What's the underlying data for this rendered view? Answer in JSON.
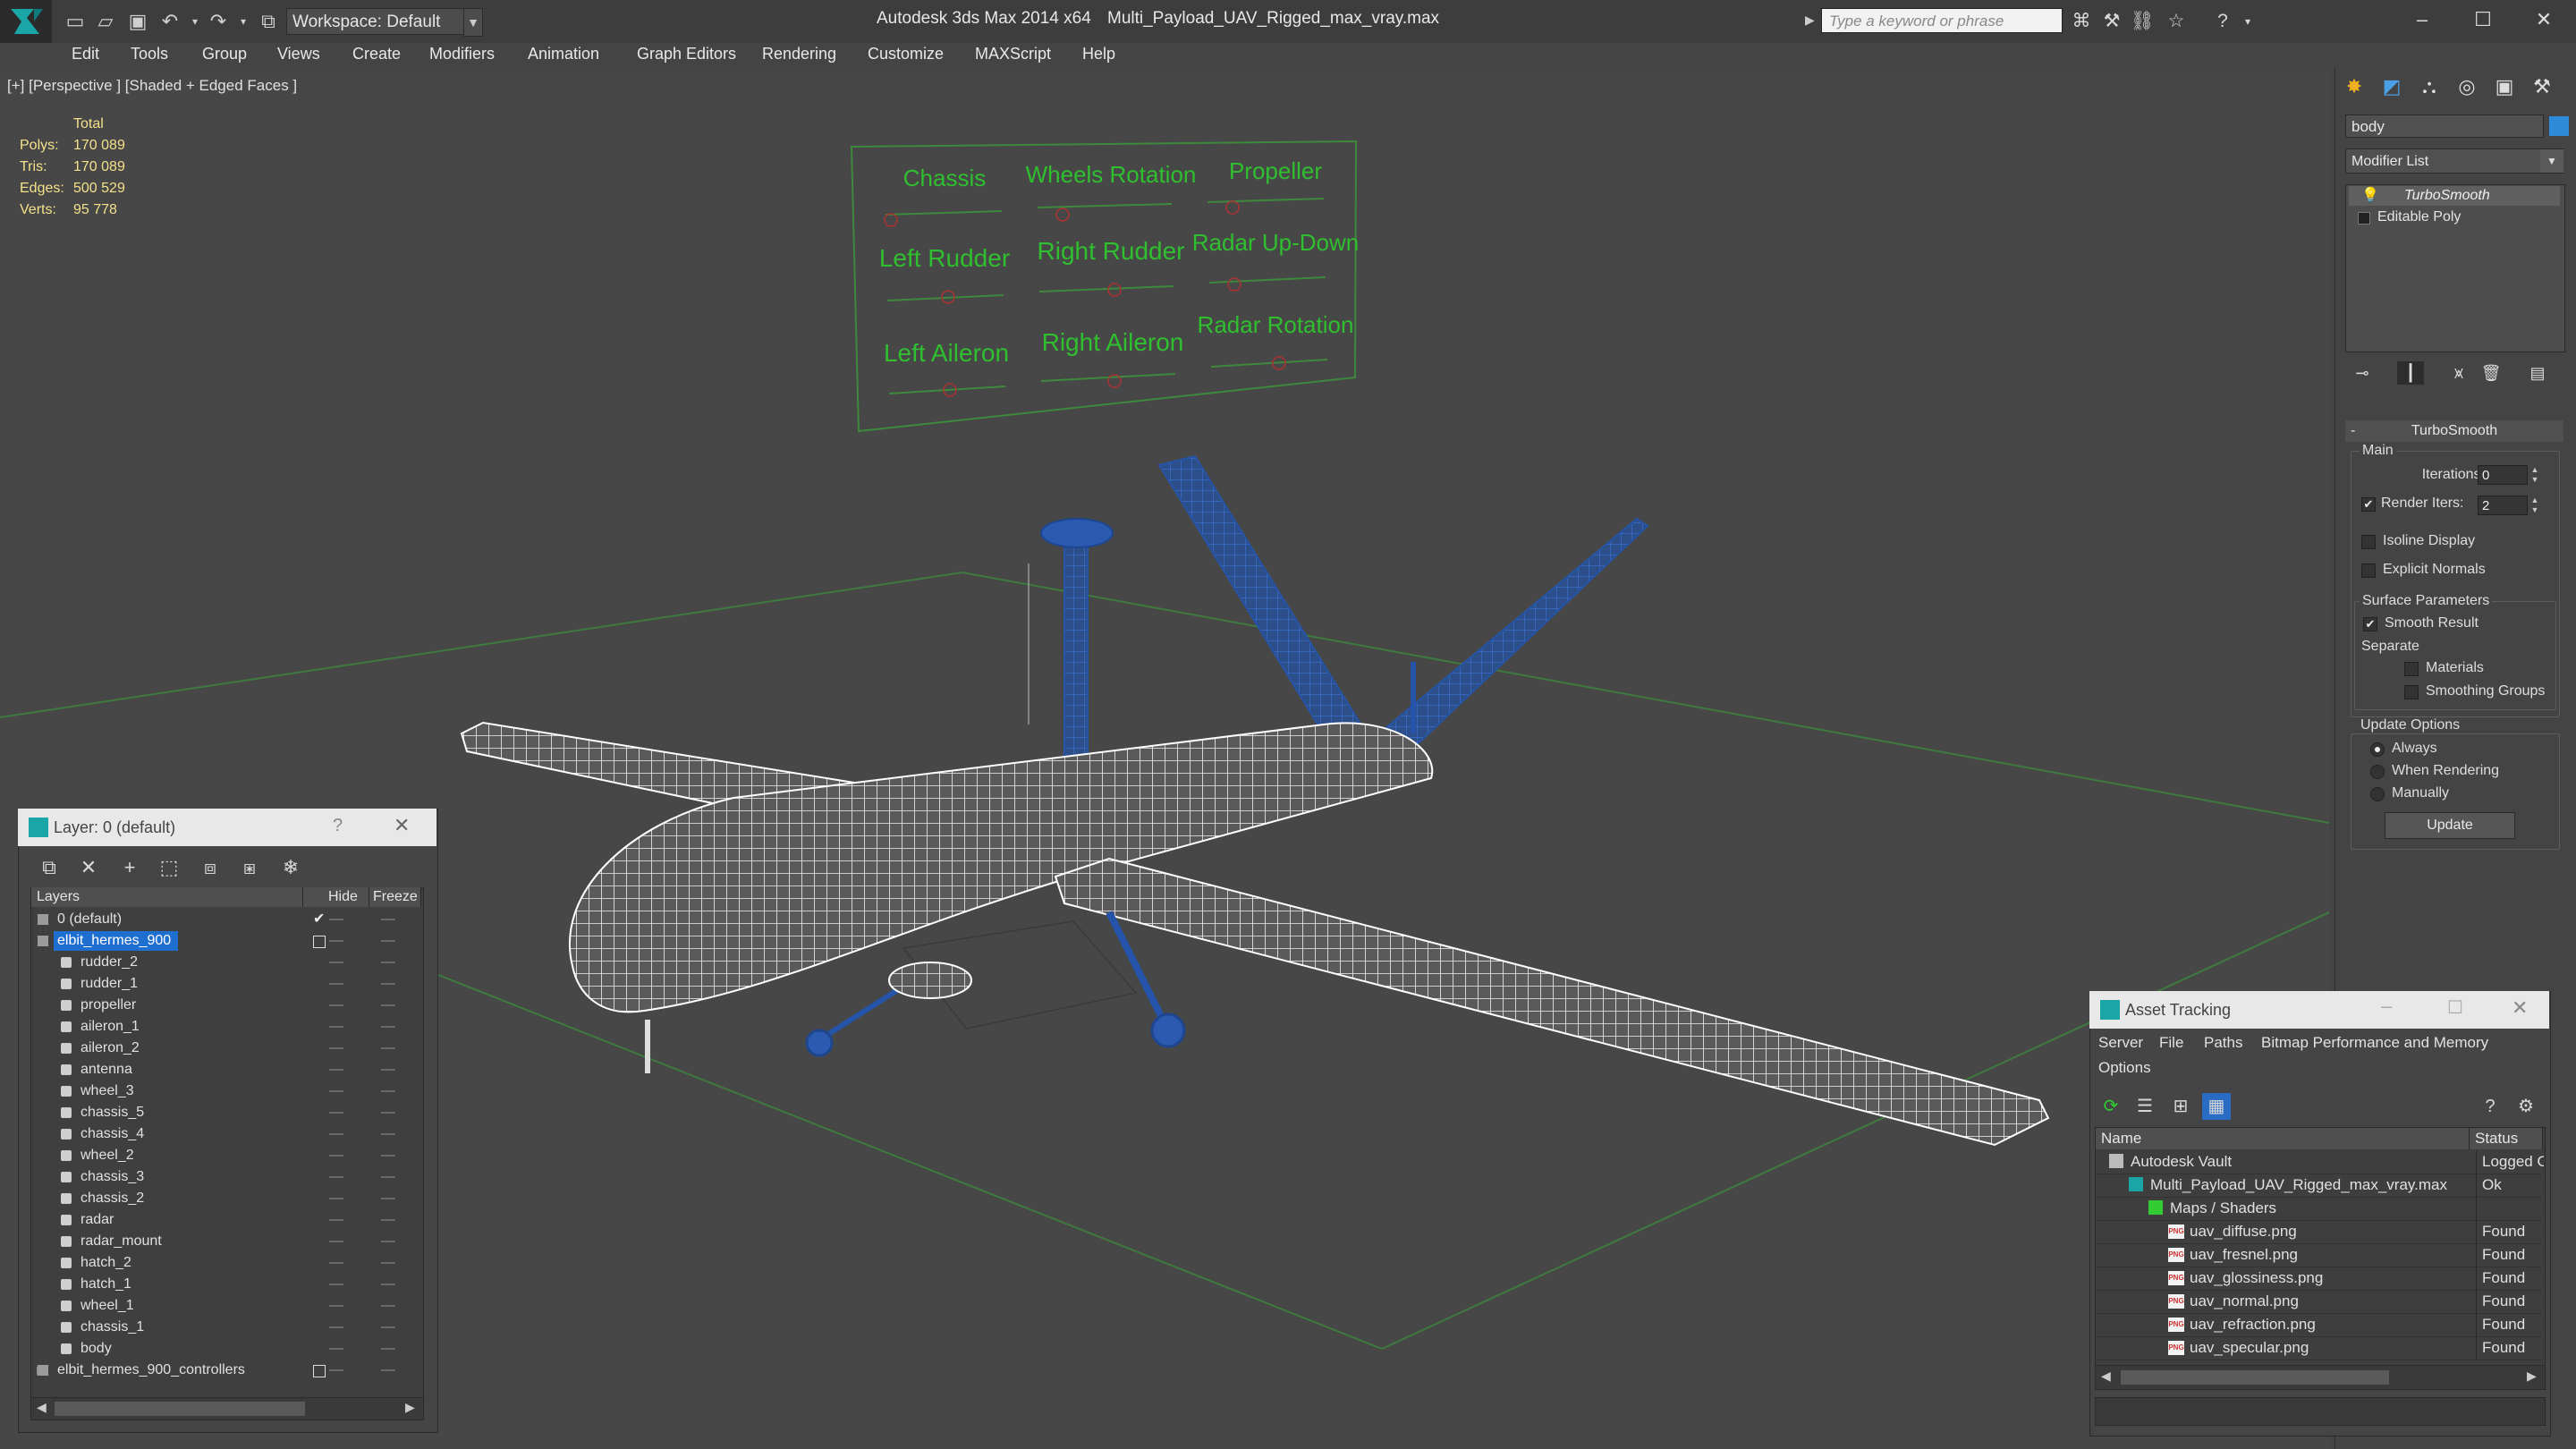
{
  "titlebar": {
    "workspace": "Workspace: Default",
    "app_title": "Autodesk 3ds Max  2014 x64",
    "file_title": "Multi_Payload_UAV_Rigged_max_vray.max",
    "search_placeholder": "Type a keyword or phrase"
  },
  "menu": [
    "Edit",
    "Tools",
    "Group",
    "Views",
    "Create",
    "Modifiers",
    "Animation",
    "Graph Editors",
    "Rendering",
    "Customize",
    "MAXScript",
    "Help"
  ],
  "viewport": {
    "label": "[+] [Perspective ] [Shaded + Edged Faces ]",
    "stats": {
      "header": "Total",
      "rows": [
        {
          "label": "Polys:",
          "value": "170 089"
        },
        {
          "label": "Tris:",
          "value": "170 089"
        },
        {
          "label": "Edges:",
          "value": "500 529"
        },
        {
          "label": "Verts:",
          "value": "95 778"
        }
      ]
    },
    "controller_board": [
      "Chassis",
      "Wheels Rotation",
      "Propeller",
      "Left Rudder",
      "Right Rudder",
      "Radar Up-Down",
      "Left Aileron",
      "Right Aileron",
      "Radar Rotation"
    ]
  },
  "command_panel": {
    "object_name": "body",
    "object_color": "#2d8bd9",
    "modifier_list": "Modifier List",
    "stack": [
      "TurboSmooth",
      "Editable Poly"
    ],
    "rollout": {
      "title": "TurboSmooth",
      "main_label": "Main",
      "iterations_label": "Iterations:",
      "iterations_value": "0",
      "render_iters_label": "Render Iters:",
      "render_iters_value": "2",
      "isoline_label": "Isoline Display",
      "explicit_label": "Explicit Normals",
      "surface_label": "Surface Parameters",
      "smooth_label": "Smooth Result",
      "separate_label": "Separate",
      "materials_label": "Materials",
      "smoothing_groups_label": "Smoothing Groups",
      "update_options_label": "Update Options",
      "always_label": "Always",
      "when_rendering_label": "When Rendering",
      "manually_label": "Manually",
      "update_button": "Update"
    }
  },
  "layer_panel": {
    "title": "Layer: 0 (default)",
    "help": "?",
    "columns": [
      "Layers",
      "Hide",
      "Freeze"
    ],
    "rows": [
      {
        "name": "0 (default)",
        "level": 0,
        "type": "layer"
      },
      {
        "name": "elbit_hermes_900",
        "level": 0,
        "type": "layer",
        "selected": true
      },
      {
        "name": "rudder_2",
        "level": 1,
        "type": "object"
      },
      {
        "name": "rudder_1",
        "level": 1,
        "type": "object"
      },
      {
        "name": "propeller",
        "level": 1,
        "type": "object"
      },
      {
        "name": "aileron_1",
        "level": 1,
        "type": "object"
      },
      {
        "name": "aileron_2",
        "level": 1,
        "type": "object"
      },
      {
        "name": "antenna",
        "level": 1,
        "type": "object"
      },
      {
        "name": "wheel_3",
        "level": 1,
        "type": "object"
      },
      {
        "name": "chassis_5",
        "level": 1,
        "type": "object"
      },
      {
        "name": "chassis_4",
        "level": 1,
        "type": "object"
      },
      {
        "name": "wheel_2",
        "level": 1,
        "type": "object"
      },
      {
        "name": "chassis_3",
        "level": 1,
        "type": "object"
      },
      {
        "name": "chassis_2",
        "level": 1,
        "type": "object"
      },
      {
        "name": "radar",
        "level": 1,
        "type": "object"
      },
      {
        "name": "radar_mount",
        "level": 1,
        "type": "object"
      },
      {
        "name": "hatch_2",
        "level": 1,
        "type": "object"
      },
      {
        "name": "hatch_1",
        "level": 1,
        "type": "object"
      },
      {
        "name": "wheel_1",
        "level": 1,
        "type": "object"
      },
      {
        "name": "chassis_1",
        "level": 1,
        "type": "object"
      },
      {
        "name": "body",
        "level": 1,
        "type": "object"
      },
      {
        "name": "elbit_hermes_900_controllers",
        "level": 0,
        "type": "layer"
      }
    ]
  },
  "asset_panel": {
    "title": "Asset Tracking",
    "menu": [
      "Server",
      "File",
      "Paths",
      "Bitmap Performance and Memory",
      "Options"
    ],
    "columns": [
      "Name",
      "Status"
    ],
    "rows": [
      {
        "name": "Autodesk Vault",
        "status": "Logged Out",
        "level": 0,
        "icon": "vault-icon"
      },
      {
        "name": "Multi_Payload_UAV_Rigged_max_vray.max",
        "status": "Ok",
        "level": 1,
        "icon": "max-file-icon"
      },
      {
        "name": "Maps / Shaders",
        "status": "",
        "level": 2,
        "icon": "maps-icon"
      },
      {
        "name": "uav_diffuse.png",
        "status": "Found",
        "level": 3,
        "icon": "png-icon"
      },
      {
        "name": "uav_fresnel.png",
        "status": "Found",
        "level": 3,
        "icon": "png-icon"
      },
      {
        "name": "uav_glossiness.png",
        "status": "Found",
        "level": 3,
        "icon": "png-icon"
      },
      {
        "name": "uav_normal.png",
        "status": "Found",
        "level": 3,
        "icon": "png-icon"
      },
      {
        "name": "uav_refraction.png",
        "status": "Found",
        "level": 3,
        "icon": "png-icon"
      },
      {
        "name": "uav_specular.png",
        "status": "Found",
        "level": 3,
        "icon": "png-icon"
      }
    ]
  }
}
